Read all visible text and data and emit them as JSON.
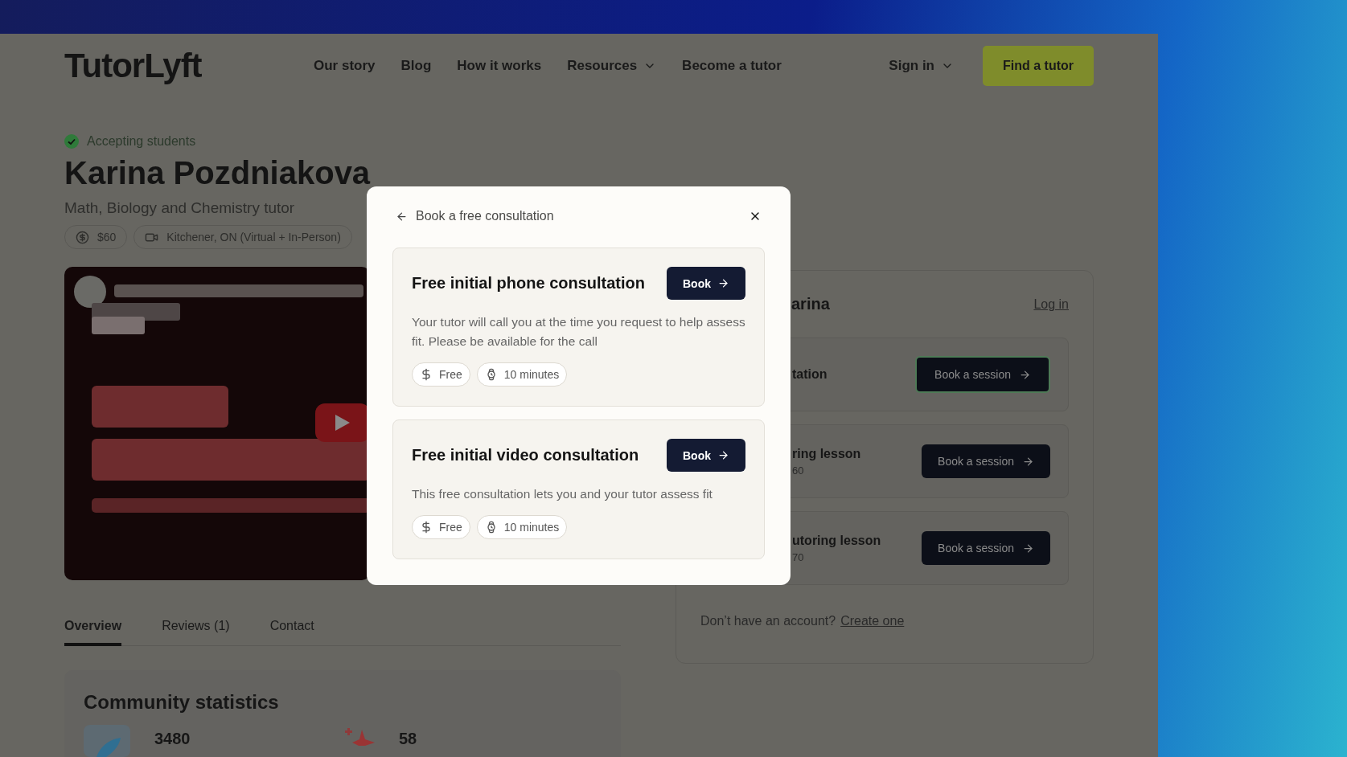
{
  "nav": {
    "logo": "TutorLyft",
    "links": [
      {
        "label": "Our story",
        "dropdown": false
      },
      {
        "label": "Blog",
        "dropdown": false
      },
      {
        "label": "How it works",
        "dropdown": false
      },
      {
        "label": "Resources",
        "dropdown": true
      },
      {
        "label": "Become a tutor",
        "dropdown": false
      }
    ],
    "sign_in": "Sign in",
    "cta": "Find a tutor"
  },
  "profile": {
    "status": "Accepting students",
    "name": "Karina Pozdniakova",
    "subtitle": "Math, Biology and Chemistry tutor",
    "chips": [
      {
        "kind": "price",
        "label": "$60"
      },
      {
        "kind": "location",
        "label": "Kitchener, ON (Virtual + In-Person)"
      }
    ]
  },
  "tabs": [
    {
      "label": "Overview",
      "selected": true
    },
    {
      "label": "Reviews (1)",
      "selected": false
    },
    {
      "label": "Contact",
      "selected": false
    }
  ],
  "stats": {
    "title": "Community statistics",
    "items": [
      {
        "kind": "sessions",
        "value": "3480"
      },
      {
        "kind": "rating",
        "value": "58"
      }
    ]
  },
  "booking_panel": {
    "title": "arina",
    "login": "Log in",
    "options": [
      {
        "title": "tation",
        "button": "Book a session",
        "focused": true
      },
      {
        "title": "ring lesson",
        "detail": "60",
        "button": "Book a session",
        "focused": false
      },
      {
        "title": "utoring lesson",
        "detail": "70",
        "button": "Book a session",
        "focused": false
      }
    ],
    "footer": "Don’t have an account?",
    "footer_link": "Create one"
  },
  "modal": {
    "title": "Book a free consultation",
    "options": [
      {
        "title": "Free initial phone consultation",
        "button": "Book",
        "description": "Your tutor will call you at the time you request to help assess fit. Please be available for the call",
        "price": "Free",
        "duration": "10 minutes"
      },
      {
        "title": "Free initial video consultation",
        "button": "Book",
        "description": "This free consultation lets you and your tutor assess fit",
        "price": "Free",
        "duration": "10 minutes"
      }
    ]
  }
}
